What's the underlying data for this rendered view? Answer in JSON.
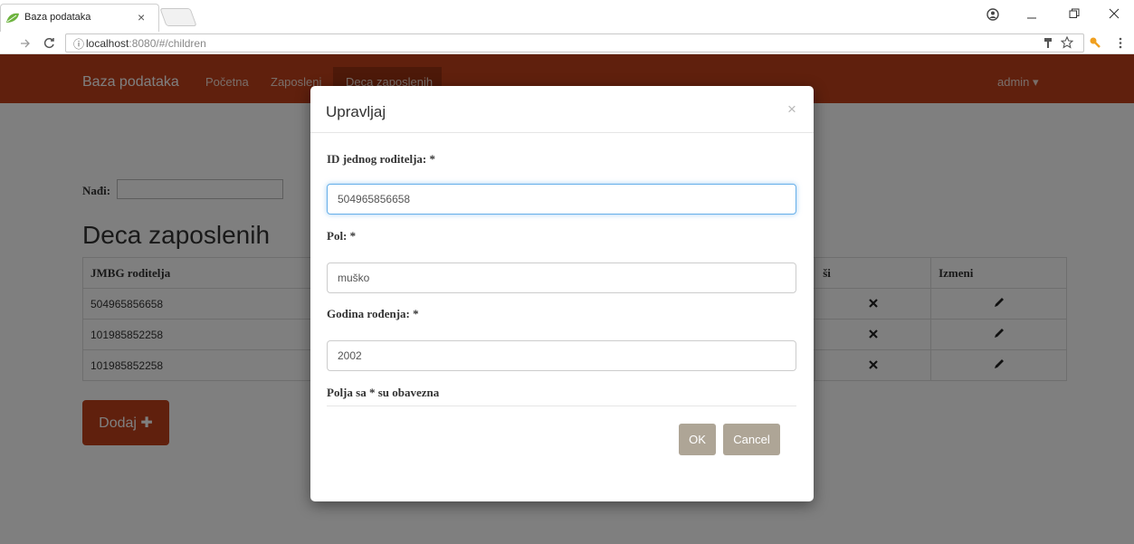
{
  "browser": {
    "tab_title": "Baza podataka",
    "tab_close": "×",
    "url_host": "localhost",
    "url_rest": ":8080/#/children",
    "info_icon": "ⓘ"
  },
  "navbar": {
    "brand": "Baza podataka",
    "items": [
      {
        "label": "Početna"
      },
      {
        "label": "Zaposleni"
      },
      {
        "label": "Deca zaposlenih"
      }
    ],
    "user": "admin ▾"
  },
  "page": {
    "search_label": "Nađi:",
    "search_value": "",
    "title": "Deca zaposlenih",
    "table": {
      "headers": [
        "JMBG roditelja",
        "",
        "ši",
        "Izmeni"
      ],
      "rows": [
        {
          "jmbg": "504965856658"
        },
        {
          "jmbg": "101985852258"
        },
        {
          "jmbg": "101985852258"
        }
      ]
    },
    "add_button": "Dodaj ✚"
  },
  "modal": {
    "title": "Upravljaj",
    "close": "×",
    "fields": [
      {
        "label": "ID jednog roditelja: *",
        "value": "504965856658"
      },
      {
        "label": "Pol: *",
        "value": "muško"
      },
      {
        "label": "Godina rođenja: *",
        "value": "2002"
      }
    ],
    "note": "Polja sa * su obavezna",
    "ok_label": "OK",
    "cancel_label": "Cancel"
  },
  "colors": {
    "navbar": "#c0401a",
    "modal_button": "#aea596",
    "focus": "#66afe9"
  }
}
